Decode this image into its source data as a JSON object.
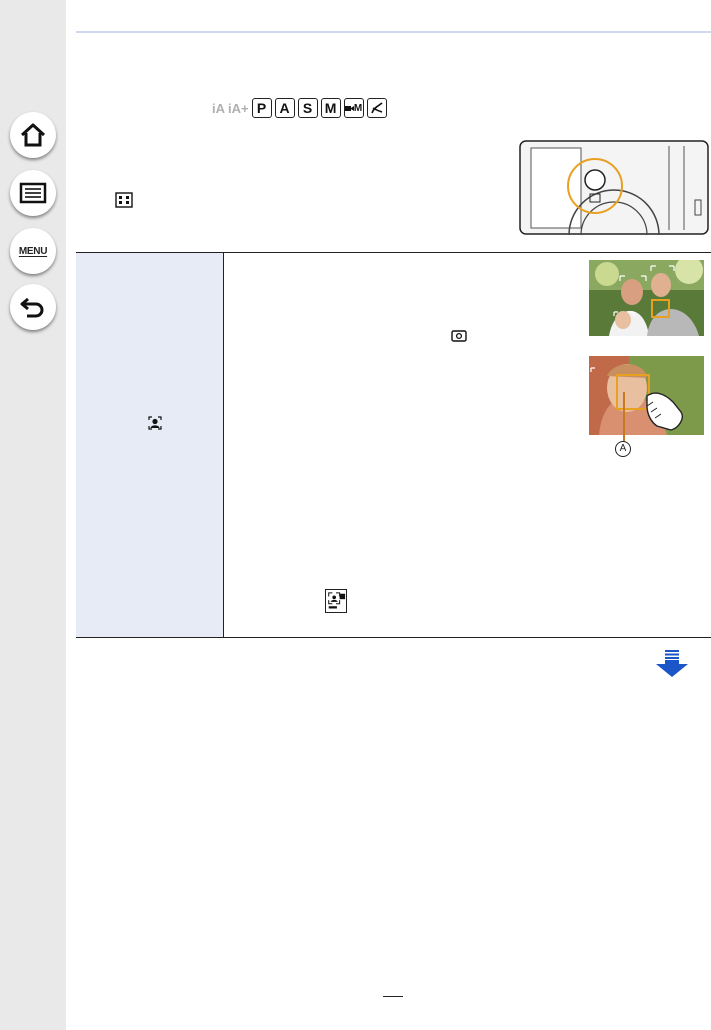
{
  "sidebar": {
    "items": [
      {
        "name": "home",
        "icon": "home-icon"
      },
      {
        "name": "contents",
        "icon": "list-icon"
      },
      {
        "name": "menu",
        "label": "MENU"
      },
      {
        "name": "back",
        "icon": "back-arrow-icon"
      }
    ]
  },
  "modes": {
    "ghost": [
      "iA",
      "iA+"
    ],
    "keys": [
      "P",
      "A",
      "S",
      "M"
    ],
    "movie_m": "M"
  },
  "callout": {
    "label": "A"
  },
  "colors": {
    "sidebar_bg": "#e9e9e9",
    "table_label_bg": "#e6ebf6",
    "accent_orange": "#e8a020",
    "next_arrow": "#1a56c8",
    "top_rule": "#cfd8ee"
  },
  "icons": [
    "af-mode-icon",
    "face-eye-detection-icon",
    "metering-icon",
    "face-af-off-icon",
    "next-page-arrow-icon"
  ]
}
